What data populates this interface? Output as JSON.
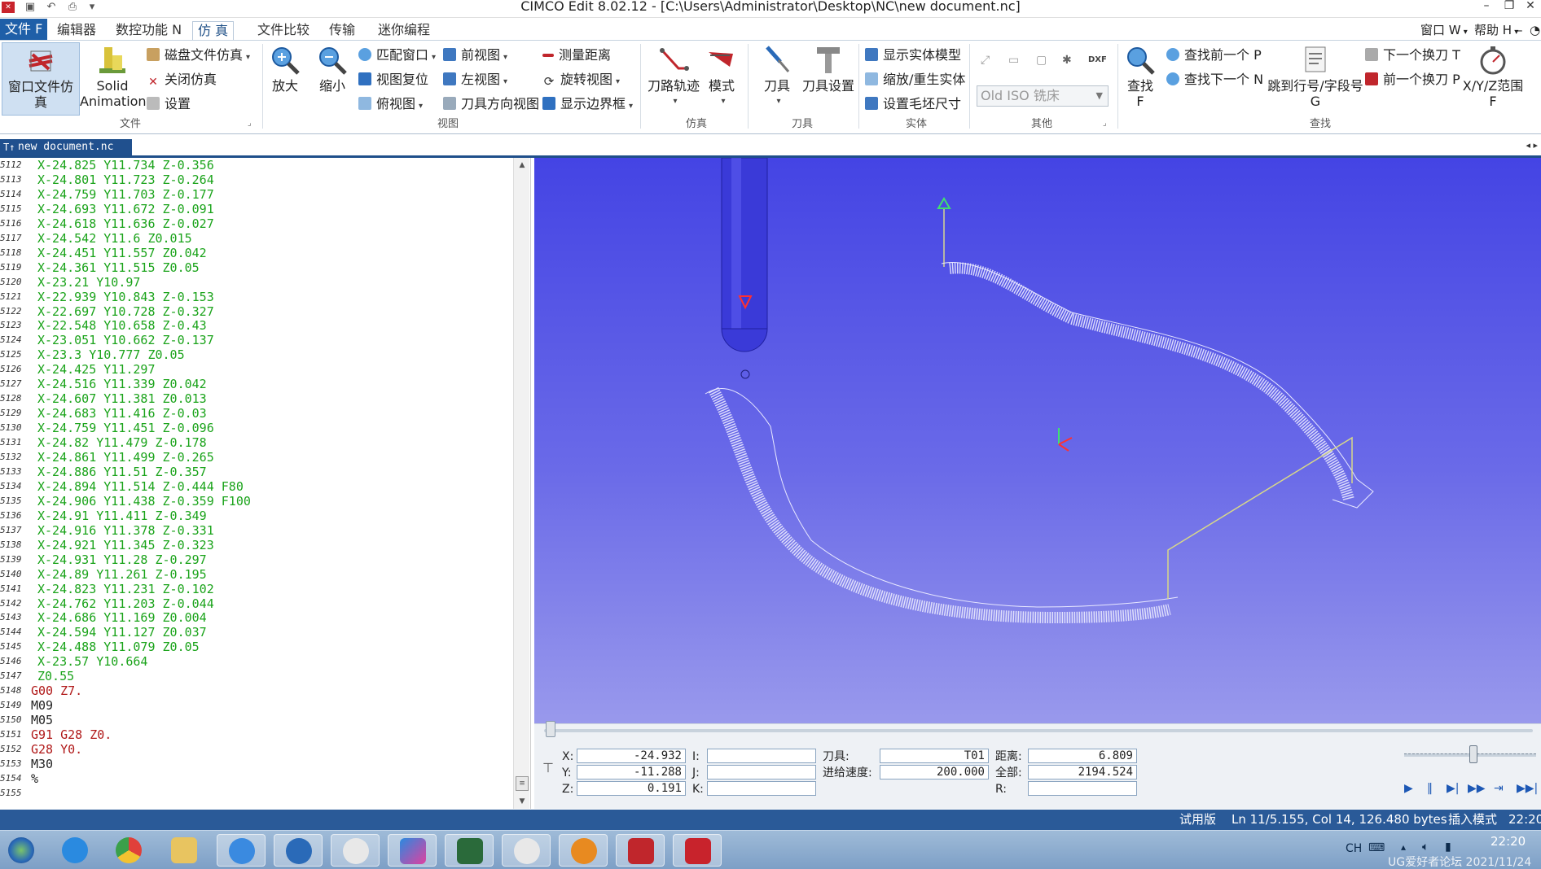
{
  "window": {
    "title": "CIMCO Edit 8.02.12 - [C:\\Users\\Administrator\\Desktop\\NC\\new document.nc]"
  },
  "tabs": [
    {
      "label": "文件 F"
    },
    {
      "label": "编辑器"
    },
    {
      "label": "数控功能 N"
    },
    {
      "label": "仿 真"
    },
    {
      "label": "文件比较"
    },
    {
      "label": "传输"
    },
    {
      "label": "迷你编程"
    }
  ],
  "menu_right": {
    "window": "窗口 W",
    "help": "帮助 H"
  },
  "ribbon": {
    "file_group": {
      "window_sim": "窗口文件仿真",
      "solid_animation_1": "Solid",
      "solid_animation_2": "Animation",
      "disk_sim": "磁盘文件仿真",
      "close_sim": "关闭仿真",
      "settings": "设置",
      "label": "文件"
    },
    "view_group": {
      "zoom_in": "放大",
      "zoom_out": "缩小",
      "fit_window": "匹配窗口",
      "reset_view": "视图复位",
      "top_view": "俯视图",
      "front_view": "前视图",
      "left_view": "左视图",
      "tool_dir_view": "刀具方向视图",
      "measure": "测量距离",
      "rotate_view": "旋转视图",
      "show_bbox": "显示边界框",
      "label": "视图"
    },
    "sim_group": {
      "toolpath": "刀路轨迹",
      "mode": "模式",
      "label": "仿真"
    },
    "tool_group": {
      "tool": "刀具",
      "tool_settings": "刀具设置",
      "label": "刀具"
    },
    "solid_group": {
      "show_solid": "显示实体模型",
      "rescale_solid": "缩放/重生实体",
      "set_stock": "设置毛坯尺寸",
      "label": "实体"
    },
    "other_group": {
      "machine_combo": "Old ISO 铣床",
      "label": "其他"
    },
    "find_group": {
      "find": "查找",
      "find_key": "F",
      "find_prev": "查找前一个 P",
      "find_next": "查找下一个 N",
      "goto_1": "跳到行号/字段号",
      "goto_2": "G",
      "next_tool": "下一个换刀 T",
      "prev_tool": "前一个换刀 P",
      "xyz_range": "X/Y/Z范围",
      "xyz_key": "F",
      "label": "查找"
    }
  },
  "document_tab": {
    "name": "new document.nc"
  },
  "code_lines": [
    {
      "num": "5112",
      "text": "X-24.825 Y11.734 Z-0.356",
      "color": "#1aa31a"
    },
    {
      "num": "5113",
      "text": "X-24.801 Y11.723 Z-0.264",
      "color": "#1aa31a"
    },
    {
      "num": "5114",
      "text": "X-24.759 Y11.703 Z-0.177",
      "color": "#1aa31a"
    },
    {
      "num": "5115",
      "text": "X-24.693 Y11.672 Z-0.091",
      "color": "#1aa31a"
    },
    {
      "num": "5116",
      "text": "X-24.618 Y11.636 Z-0.027",
      "color": "#1aa31a"
    },
    {
      "num": "5117",
      "text": "X-24.542 Y11.6 Z0.015",
      "color": "#1aa31a"
    },
    {
      "num": "5118",
      "text": "X-24.451 Y11.557 Z0.042",
      "color": "#1aa31a"
    },
    {
      "num": "5119",
      "text": "X-24.361 Y11.515 Z0.05",
      "color": "#1aa31a"
    },
    {
      "num": "5120",
      "text": "X-23.21 Y10.97",
      "color": "#1aa31a"
    },
    {
      "num": "5121",
      "text": "X-22.939 Y10.843 Z-0.153",
      "color": "#1aa31a"
    },
    {
      "num": "5122",
      "text": "X-22.697 Y10.728 Z-0.327",
      "color": "#1aa31a"
    },
    {
      "num": "5123",
      "text": "X-22.548 Y10.658 Z-0.43",
      "color": "#1aa31a"
    },
    {
      "num": "5124",
      "text": "X-23.051 Y10.662 Z-0.137",
      "color": "#1aa31a"
    },
    {
      "num": "5125",
      "text": "X-23.3 Y10.777 Z0.05",
      "color": "#1aa31a"
    },
    {
      "num": "5126",
      "text": "X-24.425 Y11.297",
      "color": "#1aa31a"
    },
    {
      "num": "5127",
      "text": "X-24.516 Y11.339 Z0.042",
      "color": "#1aa31a"
    },
    {
      "num": "5128",
      "text": "X-24.607 Y11.381 Z0.013",
      "color": "#1aa31a"
    },
    {
      "num": "5129",
      "text": "X-24.683 Y11.416 Z-0.03",
      "color": "#1aa31a"
    },
    {
      "num": "5130",
      "text": "X-24.759 Y11.451 Z-0.096",
      "color": "#1aa31a"
    },
    {
      "num": "5131",
      "text": "X-24.82 Y11.479 Z-0.178",
      "color": "#1aa31a"
    },
    {
      "num": "5132",
      "text": "X-24.861 Y11.499 Z-0.265",
      "color": "#1aa31a"
    },
    {
      "num": "5133",
      "text": "X-24.886 Y11.51 Z-0.357",
      "color": "#1aa31a"
    },
    {
      "num": "5134",
      "text": "X-24.894 Y11.514 Z-0.444 F80",
      "color": "#1aa31a"
    },
    {
      "num": "5135",
      "text": "X-24.906 Y11.438 Z-0.359 F100",
      "color": "#1aa31a"
    },
    {
      "num": "5136",
      "text": "X-24.91 Y11.411 Z-0.349",
      "color": "#1aa31a"
    },
    {
      "num": "5137",
      "text": "X-24.916 Y11.378 Z-0.331",
      "color": "#1aa31a"
    },
    {
      "num": "5138",
      "text": "X-24.921 Y11.345 Z-0.323",
      "color": "#1aa31a"
    },
    {
      "num": "5139",
      "text": "X-24.931 Y11.28 Z-0.297",
      "color": "#1aa31a"
    },
    {
      "num": "5140",
      "text": "X-24.89 Y11.261 Z-0.195",
      "color": "#1aa31a"
    },
    {
      "num": "5141",
      "text": "X-24.823 Y11.231 Z-0.102",
      "color": "#1aa31a"
    },
    {
      "num": "5142",
      "text": "X-24.762 Y11.203 Z-0.044",
      "color": "#1aa31a"
    },
    {
      "num": "5143",
      "text": "X-24.686 Y11.169 Z0.004",
      "color": "#1aa31a"
    },
    {
      "num": "5144",
      "text": "X-24.594 Y11.127 Z0.037",
      "color": "#1aa31a"
    },
    {
      "num": "5145",
      "text": "X-24.488 Y11.079 Z0.05",
      "color": "#1aa31a"
    },
    {
      "num": "5146",
      "text": "X-23.57 Y10.664",
      "color": "#1aa31a"
    },
    {
      "num": "5147",
      "text": "Z0.55",
      "color": "#1aa31a"
    },
    {
      "num": "5148",
      "text": "G00 Z7.",
      "color": "#b01818"
    },
    {
      "num": "5149",
      "text": "M09",
      "color": "#222222"
    },
    {
      "num": "5150",
      "text": "M05",
      "color": "#222222"
    },
    {
      "num": "5151",
      "text": "G91 G28 Z0.",
      "color": "#b01818"
    },
    {
      "num": "5152",
      "text": "G28 Y0.",
      "color": "#b01818"
    },
    {
      "num": "5153",
      "text": "M30",
      "color": "#222222"
    },
    {
      "num": "5154",
      "text": "%",
      "color": "#222222"
    },
    {
      "num": "5155",
      "text": "",
      "color": "#222222"
    }
  ],
  "sim_panel": {
    "x_label": "X:",
    "x_value": "-24.932",
    "y_label": "Y:",
    "y_value": "-11.288",
    "z_label": "Z:",
    "z_value": "0.191",
    "i_label": "I:",
    "j_label": "J:",
    "k_label": "K:",
    "tool_label": "刀具:",
    "tool_value": "T01",
    "feed_label": "进给速度:",
    "feed_value": "200.000",
    "dist_label": "距离:",
    "dist_value": "6.809",
    "total_label": "全部:",
    "total_value": "2194.524",
    "r_label": "R:"
  },
  "status": {
    "trial": "试用版",
    "position": "Ln 11/5.155, Col 14, 126.480 bytes",
    "mode": "插入模式",
    "time": "22:20"
  },
  "taskbar": {
    "lang": "CH",
    "clock": "22:20",
    "watermark": "UG爱好者论坛 2021/11/24"
  }
}
